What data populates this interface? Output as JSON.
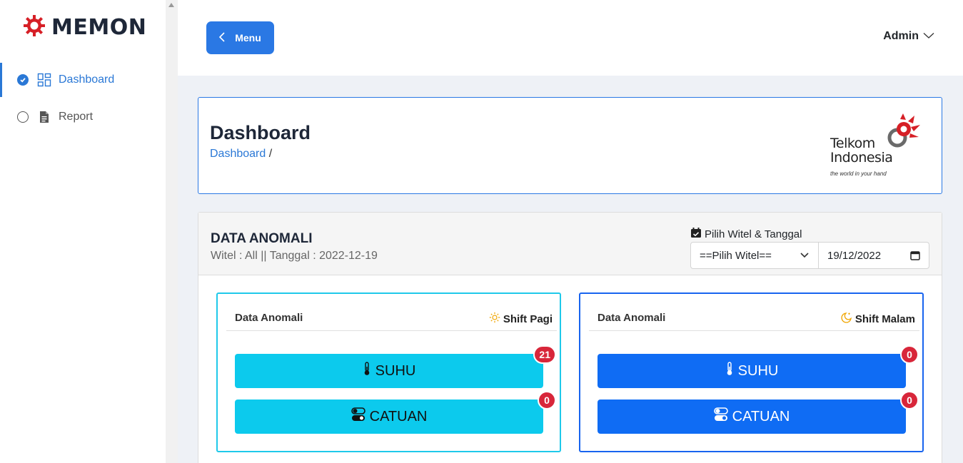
{
  "app": {
    "name": "MEMON"
  },
  "sidebar": {
    "items": [
      {
        "label": "Dashboard",
        "active": true
      },
      {
        "label": "Report",
        "active": false
      }
    ]
  },
  "topbar": {
    "menu_label": "Menu",
    "user_label": "Admin"
  },
  "header": {
    "title": "Dashboard",
    "breadcrumb_link": "Dashboard",
    "breadcrumb_sep": "/",
    "logo_name_line1": "Telkom",
    "logo_name_line2": "Indonesia",
    "logo_tagline": "the world in your hand"
  },
  "panel": {
    "title": "DATA ANOMALI",
    "subtitle": "Witel : All || Tanggal : 2022-12-19",
    "picker_label": "Pilih Witel & Tanggal",
    "witel_selected": "==Pilih Witel==",
    "date_value": "19/12/2022"
  },
  "shifts": [
    {
      "title": "Data Anomali",
      "name": "Shift Pagi",
      "suhu_label": "SUHU",
      "suhu_count": "21",
      "catuan_label": "CATUAN",
      "catuan_count": "0"
    },
    {
      "title": "Data Anomali",
      "name": "Shift Malam",
      "suhu_label": "SUHU",
      "suhu_count": "0",
      "catuan_label": "CATUAN",
      "catuan_count": "0"
    }
  ],
  "colors": {
    "primary": "#2a78e4",
    "pagi_accent": "#0ccaed",
    "malam_accent": "#0f6cf4",
    "badge": "#d8263a",
    "logo_red": "#d61f26"
  }
}
